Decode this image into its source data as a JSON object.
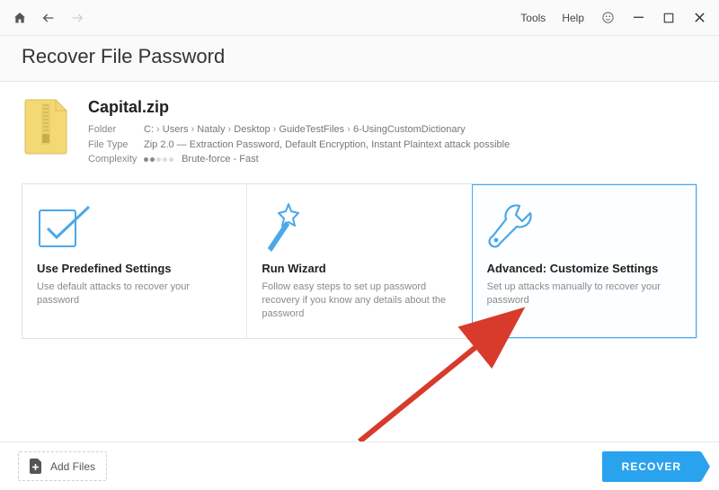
{
  "toolbar": {
    "tools": "Tools",
    "help": "Help"
  },
  "page_title": "Recover File Password",
  "file": {
    "name": "Capital.zip",
    "folder_label": "Folder",
    "folder_parts": [
      "C:",
      "Users",
      "Nataly",
      "Desktop",
      "GuideTestFiles",
      "6-UsingCustomDictionary"
    ],
    "type_label": "File Type",
    "type_value": "Zip 2.0 — Extraction Password, Default Encryption, Instant Plaintext attack possible",
    "complexity_label": "Complexity",
    "complexity_text": "Brute-force - Fast",
    "complexity_filled": 2,
    "complexity_total": 5
  },
  "cards": {
    "predefined": {
      "title": "Use Predefined Settings",
      "desc": "Use default attacks to recover your password"
    },
    "wizard": {
      "title": "Run Wizard",
      "desc": "Follow easy steps to set up password recovery if you know any details about the password"
    },
    "advanced": {
      "title": "Advanced: Customize Settings",
      "desc": "Set up attacks manually to recover your password"
    }
  },
  "footer": {
    "add_files": "Add Files",
    "recover": "RECOVER"
  }
}
